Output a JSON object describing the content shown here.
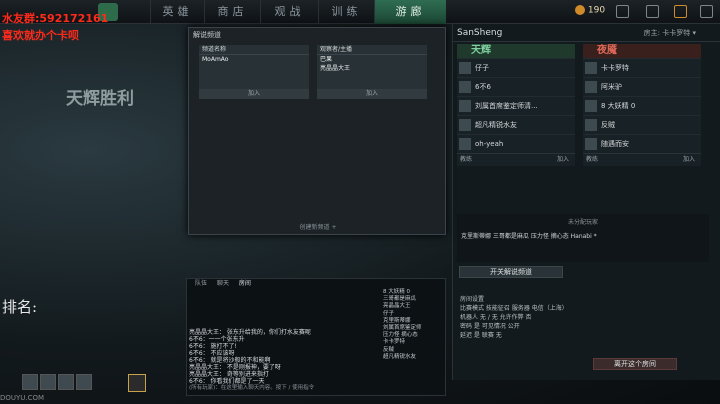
{
  "overlay": {
    "line1": "水友群:592172161",
    "line2": "喜欢就办个卡呗",
    "hero_text": "天辉胜利",
    "rank_label": "排名:",
    "watermark": "DOUYU.COM"
  },
  "nav": {
    "tabs": [
      "英雄",
      "商店",
      "观战",
      "训练",
      "游廊"
    ],
    "coins": "190",
    "coin_sub": "4"
  },
  "lobby": {
    "title": "SanSheng",
    "owner": "房主: 卡卡罗特 ▾",
    "radiant": {
      "name": "天辉",
      "players": [
        "仔子",
        "6不6",
        "刘属首席鉴定师清...",
        "超凡精锐水友",
        "oh-yeah"
      ],
      "coach": "教练",
      "join": "加入"
    },
    "dire": {
      "name": "夜魇",
      "players": [
        "卡卡罗特",
        "阿米驴",
        "8 大妖精 0",
        "反贼",
        "随遇而安"
      ],
      "coach": "教练",
      "join": "加入"
    },
    "unassigned_title": "未分配玩家",
    "unassigned_list": "克里斯蒂娜    三哥都是麻瓜    压力怪 摘心态    Hanabi *",
    "caster_btn": "开关解说频道",
    "settings": {
      "title": "房间设置",
      "rows": [
        "比赛模式  技能征召       服务器  电信（上海）",
        "机器人  无 / 无            允许作弊  否",
        "密码  是                      可见情况  公开",
        "延迟  是                      联赛  无"
      ]
    },
    "leave_btn": "离开这个房间"
  },
  "dialog": {
    "title": "解说频道",
    "col1": {
      "head": "频道名称",
      "rows": [
        "MoAmAo"
      ],
      "join": "加入"
    },
    "col2": {
      "head": "观察者/主播",
      "rows": [
        "巴果",
        "亮晶晶大王"
      ],
      "join": "加入"
    },
    "create": "创建新频道 +"
  },
  "chat": {
    "tabs": [
      "队伍",
      "聊天",
      "房间"
    ],
    "lines": [
      "亮晶晶大王：  张东升给我的，你们打水友赛呢",
      "6不6：一一个张东升",
      "6不6：  施打不了!",
      "6不6：  不应该呀",
      "6不6：  就是将沙般的不和能啊",
      "亮晶晶大王：  不是刚报神，要了呀",
      "亮晶晶大王：  奇等别进来指打",
      "6不6：  你看我们都是了一天"
    ],
    "users": [
      "8 大妖精 0",
      "三哥都是麻瓜",
      "亮晶晶大王",
      "仔子",
      "克里斯蒂娜",
      "刘属首席鉴定师",
      "压力怪 摘心态",
      "卡卡罗特",
      "反贼",
      "超凡精锐水友"
    ],
    "input": "(所有玩家)：在这里输入聊天内容。按下 / 使用指令"
  }
}
